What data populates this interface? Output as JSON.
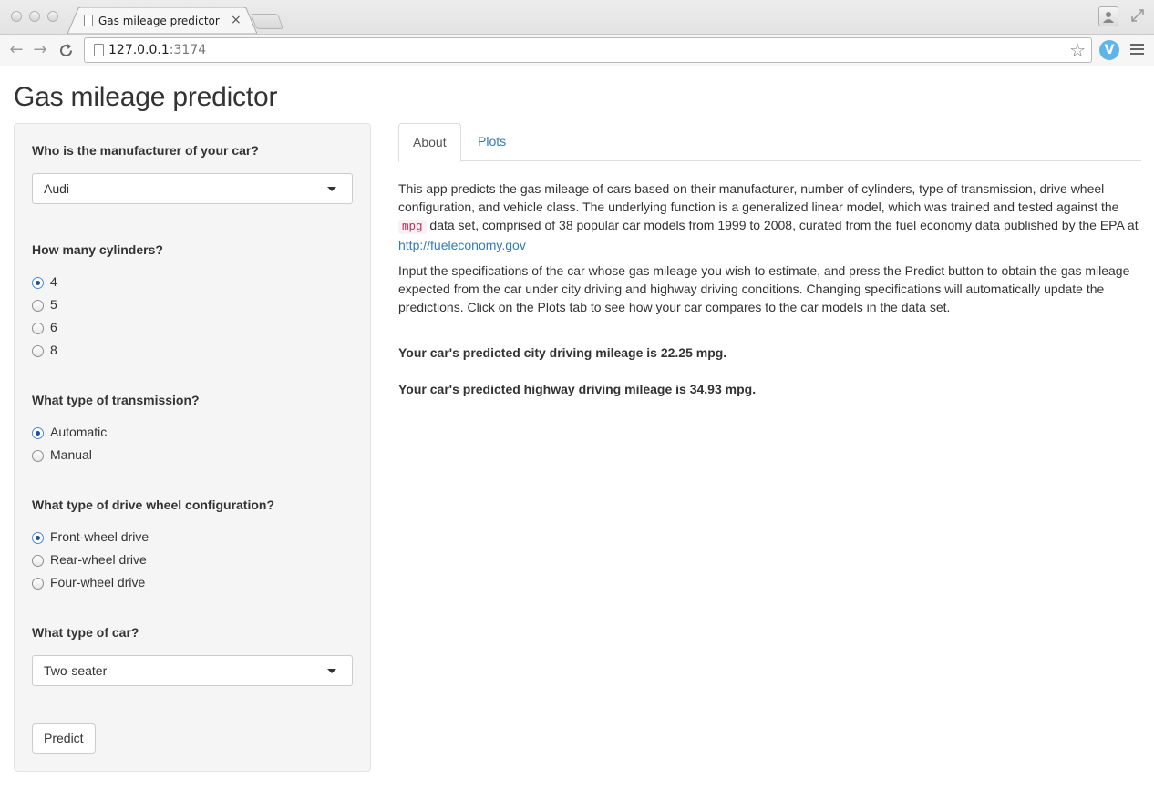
{
  "browser": {
    "tab_title": "Gas mileage predictor",
    "tab_close": "×",
    "url_host": "127.0.0.1",
    "url_port": ":3174",
    "extension_letter": "V"
  },
  "page": {
    "title": "Gas mileage predictor"
  },
  "sidebar": {
    "manufacturer": {
      "label": "Who is the manufacturer of your car?",
      "selected": "Audi"
    },
    "cylinders": {
      "label": "How many cylinders?",
      "options": [
        "4",
        "5",
        "6",
        "8"
      ],
      "selected": "4"
    },
    "transmission": {
      "label": "What type of transmission?",
      "options": [
        "Automatic",
        "Manual"
      ],
      "selected": "Automatic"
    },
    "drive": {
      "label": "What type of drive wheel configuration?",
      "options": [
        "Front-wheel drive",
        "Rear-wheel drive",
        "Four-wheel drive"
      ],
      "selected": "Front-wheel drive"
    },
    "car_type": {
      "label": "What type of car?",
      "selected": "Two-seater"
    },
    "predict_label": "Predict"
  },
  "main": {
    "tabs": [
      {
        "label": "About",
        "active": true
      },
      {
        "label": "Plots",
        "active": false
      }
    ],
    "about": {
      "p1_a": "This app predicts the gas mileage of cars based on their manufacturer, number of cylinders, type of transmission, drive wheel configuration, and vehicle class. The underlying function is a generalized linear model, which was trained and tested against the",
      "p1_code": "mpg",
      "p1_b": "data set, comprised of 38 popular car models from 1999 to 2008, curated from the fuel economy data published by the EPA at",
      "p1_link": "http://fueleconomy.gov",
      "p2": "Input the specifications of the car whose gas mileage you wish to estimate, and press the Predict button to obtain the gas mileage expected from the car under city driving and highway driving conditions. Changing specifications will automatically update the predictions. Click on the Plots tab to see how your car compares to the car models in the data set.",
      "city_result": "Your car's predicted city driving mileage is 22.25 mpg.",
      "highway_result": "Your car's predicted highway driving mileage is 34.93 mpg."
    }
  }
}
